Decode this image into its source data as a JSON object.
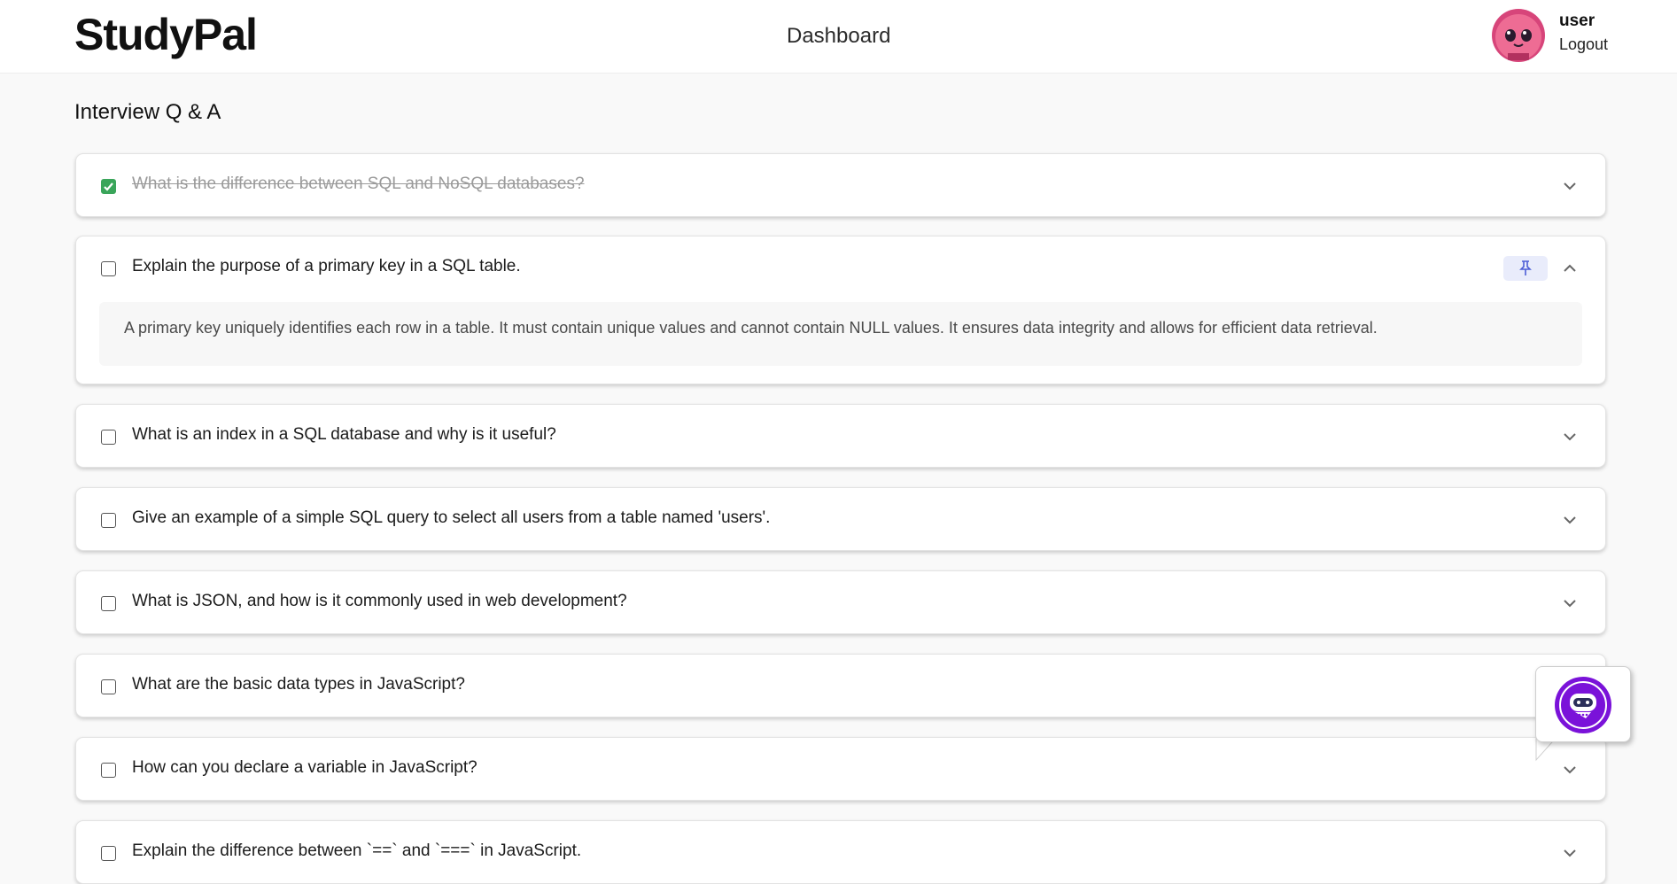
{
  "header": {
    "logo": "StudyPal",
    "nav_dashboard": "Dashboard",
    "user_name": "user",
    "logout": "Logout"
  },
  "page": {
    "title": "Interview Q & A"
  },
  "colors": {
    "checked": "#3aa55a",
    "pin_bg": "#e9ecfb",
    "bot_purple": "#7a12d9"
  },
  "questions": [
    {
      "text": "What is the difference between SQL and NoSQL databases?",
      "checked": true,
      "expanded": false
    },
    {
      "text": "Explain the purpose of a primary key in a SQL table.",
      "checked": false,
      "expanded": true,
      "answer": "A primary key uniquely identifies each row in a table. It must contain unique values and cannot contain NULL values. It ensures data integrity and allows for efficient data retrieval."
    },
    {
      "text": "What is an index in a SQL database and why is it useful?",
      "checked": false,
      "expanded": false
    },
    {
      "text": "Give an example of a simple SQL query to select all users from a table named 'users'.",
      "checked": false,
      "expanded": false
    },
    {
      "text": "What is JSON, and how is it commonly used in web development?",
      "checked": false,
      "expanded": false
    },
    {
      "text": "What are the basic data types in JavaScript?",
      "checked": false,
      "expanded": false
    },
    {
      "text": "How can you declare a variable in JavaScript?",
      "checked": false,
      "expanded": false
    },
    {
      "text": "Explain the difference between `==` and `===` in JavaScript.",
      "checked": false,
      "expanded": false
    }
  ],
  "icons": {
    "pin": "pin-icon",
    "chevron_down": "chevron-down-icon",
    "chevron_up": "chevron-up-icon",
    "chatbot": "chatbot-icon",
    "avatar": "avatar"
  }
}
